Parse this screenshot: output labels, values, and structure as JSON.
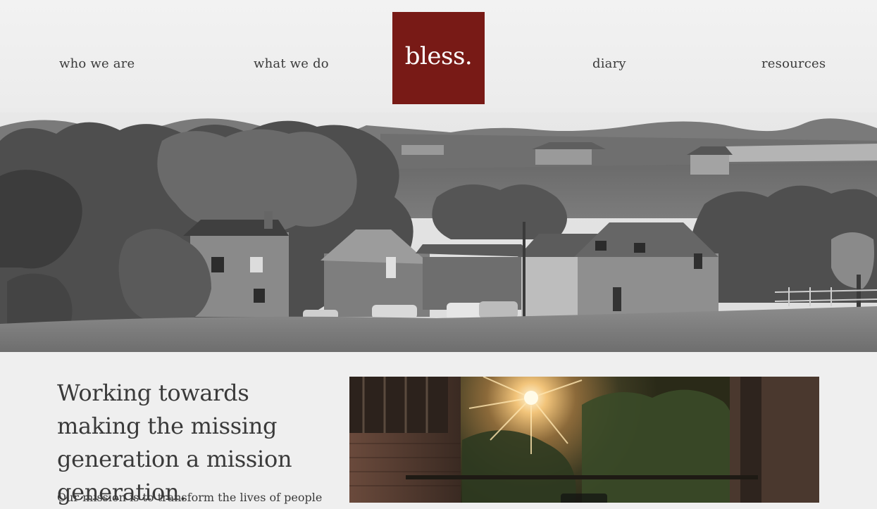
{
  "nav": {
    "left": [
      "who we are",
      "what we do"
    ],
    "right": [
      "diary",
      "resources"
    ]
  },
  "logo": {
    "text": "bless."
  },
  "colors": {
    "brand": "#781a16",
    "text": "#3a3a3a",
    "background": "#efefef"
  },
  "hero": {
    "image": "grayscale countryside village photo"
  },
  "intro": {
    "headline": "Working towards making the missing generation a mission generation.",
    "text": "Our mission is to transform the lives of people"
  },
  "video": {
    "thumbnail": "sunset behind trees framed by brick walls",
    "control": "play-icon"
  }
}
